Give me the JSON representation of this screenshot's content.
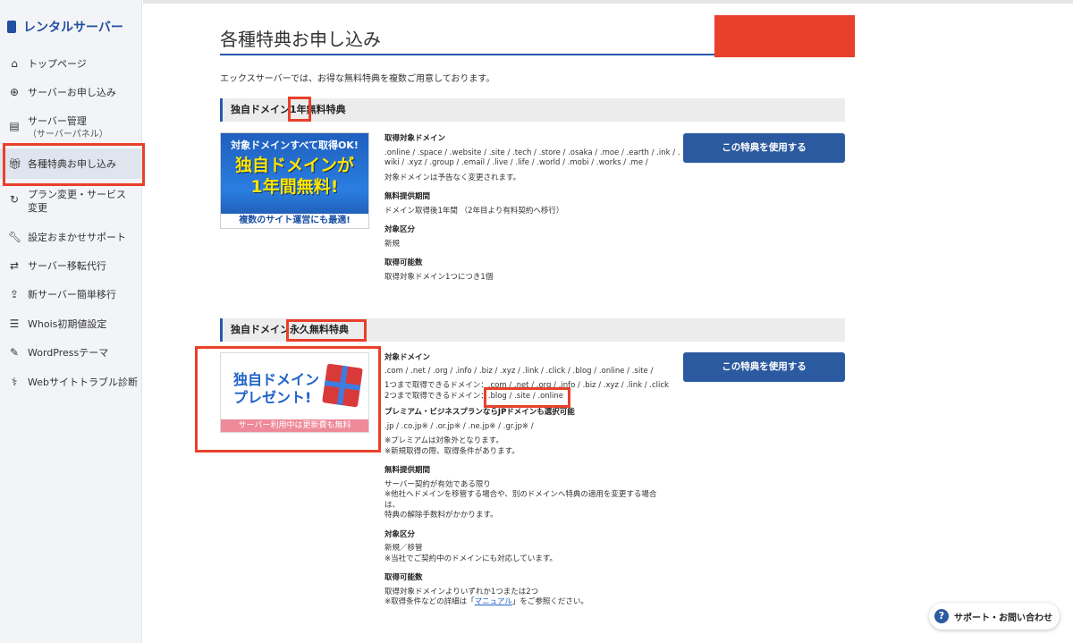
{
  "sidebar": {
    "brand": "レンタルサーバー",
    "items": [
      {
        "icon": "home-icon",
        "label": "トップページ"
      },
      {
        "icon": "plus-circle-icon",
        "label": "サーバーお申し込み"
      },
      {
        "icon": "server-icon",
        "label": "サーバー管理",
        "sub": "（サーバーパネル）"
      },
      {
        "icon": "gift-icon",
        "label": "各種特典お申し込み"
      },
      {
        "icon": "refresh-icon",
        "label": "プラン変更・サービス変更"
      },
      {
        "icon": "wrench-icon",
        "label": "設定おまかせサポート"
      },
      {
        "icon": "transfer-icon",
        "label": "サーバー移転代行"
      },
      {
        "icon": "upload-user-icon",
        "label": "新サーバー簡単移行"
      },
      {
        "icon": "document-icon",
        "label": "Whois初期値設定"
      },
      {
        "icon": "edit-icon",
        "label": "WordPressテーマ"
      },
      {
        "icon": "diagnosis-icon",
        "label": "Webサイトトラブル診断"
      }
    ]
  },
  "main": {
    "title": "各種特典お申し込み",
    "intro": "エックスサーバーでは、お得な無料特典を複数ご用意しております。",
    "sections": [
      {
        "heading": "独自ドメイン1年無料特典",
        "banner": {
          "line1": "対象ドメインすべて取得OK!",
          "line2": "独自ドメインが",
          "line3": "1年間無料!",
          "line4": "複数のサイト運営にも最適!"
        },
        "button": "この特典を使用する",
        "info": [
          {
            "h": "取得対象ドメイン",
            "lines": [
              ".online / .space / .website / .site / .tech / .store / .osaka / .moe / .earth / .ink / .",
              "wiki / .xyz / .group / .email / .live / .life / .world / .mobi / .works / .me /",
              "",
              "対象ドメインは予告なく変更されます。"
            ]
          },
          {
            "h": "無料提供期間",
            "lines": [
              "ドメイン取得後1年間 （2年目より有料契約へ移行）"
            ]
          },
          {
            "h": "対象区分",
            "lines": [
              "新規"
            ]
          },
          {
            "h": "取得可能数",
            "lines": [
              "取得対象ドメイン1つにつき1個"
            ]
          }
        ]
      },
      {
        "heading": "独自ドメイン永久無料特典",
        "banner": {
          "line1": "独自ドメイン",
          "line2": "プレゼント!",
          "bar": "サーバー利用中は更新費も無料"
        },
        "button": "この特典を使用する",
        "info": {
          "h1": "対象ドメイン",
          "l1": ".com / .net / .org / .info / .biz / .xyz / .link / .click / .blog / .online / .site /",
          "l2": "1つまで取得できるドメイン：.com / .net / .org / .info / .biz / .xyz / .link / .click",
          "l3": "2つまで取得できるドメイン：",
          "l3b": ".blog / .site / .online",
          "h2": "プレミアム・ビジネスプランならJPドメインも選択可能",
          "l4": ".jp / .co.jp※ / .or.jp※ / .ne.jp※ / .gr.jp※ /",
          "l5": "※プレミアムは対象外となります。",
          "l6": "※新規取得の際、取得条件があります。",
          "h3": "無料提供期間",
          "l7": "サーバー契約が有効である限り",
          "l8": "※他社へドメインを移管する場合や、別のドメインへ特典の適用を変更する場合",
          "l9": "は、",
          "l10": "特典の解除手数料がかかります。",
          "h4": "対象区分",
          "l11": "新規／移管",
          "l12": "※当社でご契約中のドメインにも対応しています。",
          "h5": "取得可能数",
          "l13": "取得対象ドメインよりいずれか1つまたは2つ",
          "l14a": "※取得条件などの詳細は「",
          "l14link": "マニュアル",
          "l14b": "」をご参照ください。"
        }
      }
    ]
  },
  "support": {
    "icon": "question-icon",
    "label": "サポート・お問い合わせ"
  },
  "colors": {
    "accent": "#2c5aa0",
    "highlight": "#e8402a"
  }
}
